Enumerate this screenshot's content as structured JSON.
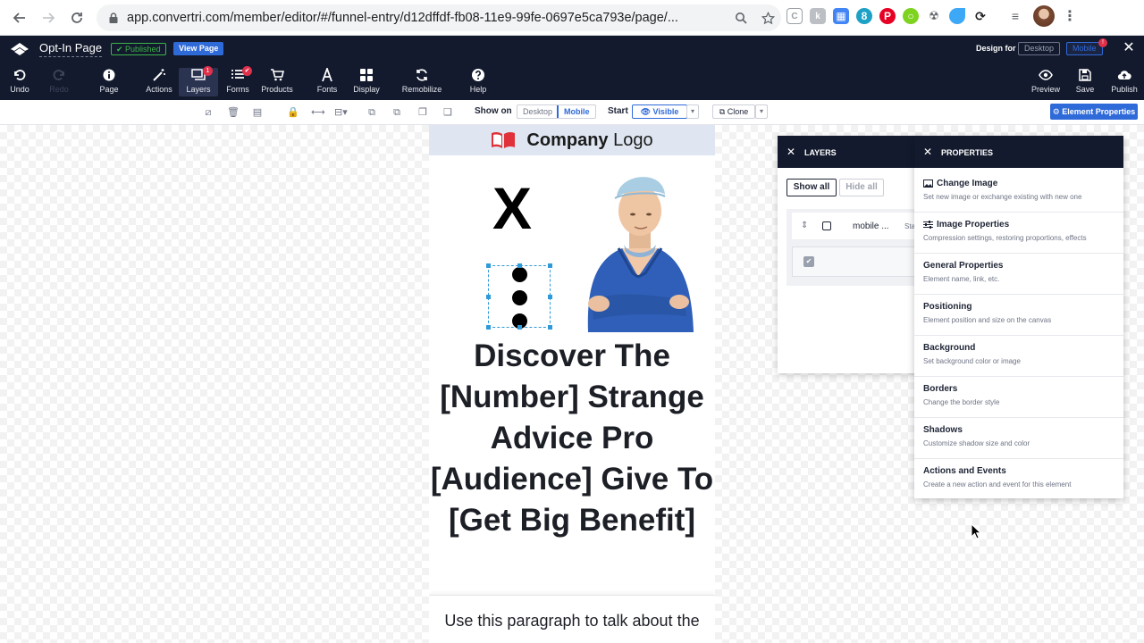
{
  "browser": {
    "url": "app.convertri.com/member/editor/#/funnel-entry/d12dffdf-fb08-11e9-99fe-0697e5ca793e/page/..."
  },
  "header": {
    "page_name": "Opt-In Page",
    "published_label": "Published",
    "view_page_label": "View Page",
    "design_for_label": "Design for",
    "desktop_label": "Desktop",
    "mobile_label": "Mobile",
    "mobile_alert": "!"
  },
  "toolbar": {
    "undo": "Undo",
    "redo": "Redo",
    "page": "Page",
    "actions": "Actions",
    "layers": "Layers",
    "layers_badge": "1",
    "forms": "Forms",
    "products": "Products",
    "fonts": "Fonts",
    "display": "Display",
    "remobilize": "Remobilize",
    "help": "Help",
    "preview": "Preview",
    "save": "Save",
    "publish": "Publish"
  },
  "element_toolbar": {
    "show_on_label": "Show on",
    "desktop": "Desktop",
    "mobile": "Mobile",
    "start_label": "Start",
    "visible": "Visible",
    "clone": "Clone",
    "element_properties": "Element Properties"
  },
  "page": {
    "logo_bold": "Company",
    "logo_light": " Logo",
    "hero_x": "X",
    "headline": "Discover The [Number] Strange Advice Pro [Audience] Give To [Get Big Benefit]",
    "paragraph": "Use this paragraph to talk about the"
  },
  "layers_panel": {
    "title": "LAYERS",
    "show_all": "Show all",
    "hide_all": "Hide all",
    "row_name": "mobile ...",
    "row_start": "Start"
  },
  "properties_panel": {
    "title": "PROPERTIES",
    "items": [
      {
        "title": "Change Image",
        "desc": "Set new image or exchange existing with new one",
        "icon": "image-icon"
      },
      {
        "title": "Image Properties",
        "desc": "Compression settings, restoring proportions, effects",
        "icon": "sliders-icon"
      },
      {
        "title": "General Properties",
        "desc": "Element name, link, etc."
      },
      {
        "title": "Positioning",
        "desc": "Element position and size on the canvas"
      },
      {
        "title": "Background",
        "desc": "Set background color or image"
      },
      {
        "title": "Borders",
        "desc": "Change the border style"
      },
      {
        "title": "Shadows",
        "desc": "Customize shadow size and color"
      },
      {
        "title": "Actions and Events",
        "desc": "Create a new action and event for this element"
      }
    ]
  },
  "colors": {
    "header_bg": "#131a2d",
    "accent_blue": "#2f6ad9",
    "published_green": "#3cb34a",
    "badge_red": "#e0314b",
    "logo_red": "#e0313b"
  }
}
